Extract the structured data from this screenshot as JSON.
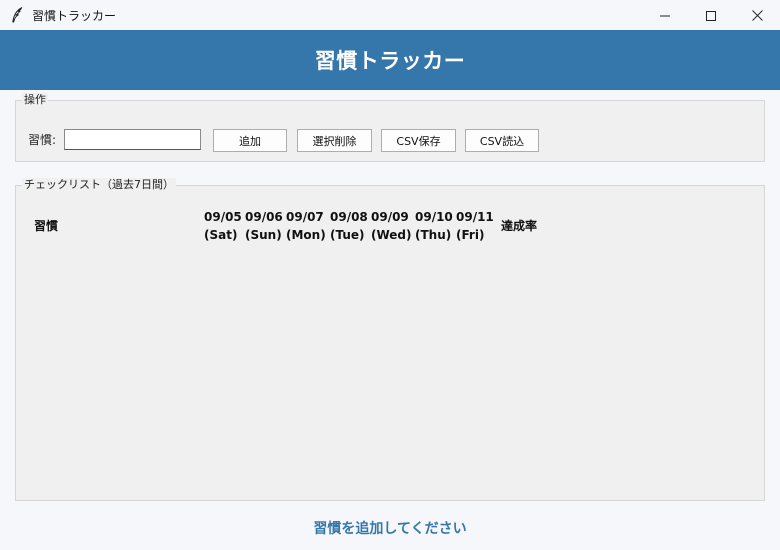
{
  "window": {
    "title": "習慣トラッカー",
    "icon": "feather-icon",
    "controls": [
      "minimize-icon",
      "maximize-icon",
      "close-icon"
    ]
  },
  "header": {
    "title": "習慣トラッカー",
    "background": "#3677ab"
  },
  "operations": {
    "legend": "操作",
    "habit_label": "習慣:",
    "habit_value": "",
    "buttons": {
      "add": "追加",
      "delete_selected": "選択削除",
      "csv_save": "CSV保存",
      "csv_load": "CSV読込"
    }
  },
  "checklist": {
    "legend": "チェックリスト（過去7日間）",
    "columns": {
      "habit": "習慣",
      "days": [
        {
          "date": "09/05",
          "weekday": "(Sat)"
        },
        {
          "date": "09/06",
          "weekday": "(Sun)"
        },
        {
          "date": "09/07",
          "weekday": "(Mon)"
        },
        {
          "date": "09/08",
          "weekday": "(Tue)"
        },
        {
          "date": "09/09",
          "weekday": "(Wed)"
        },
        {
          "date": "09/10",
          "weekday": "(Thu)"
        },
        {
          "date": "09/11",
          "weekday": "(Fri)"
        }
      ],
      "rate": "達成率"
    },
    "rows": []
  },
  "status": {
    "message": "習慣を追加してください",
    "color": "#3677ab"
  }
}
